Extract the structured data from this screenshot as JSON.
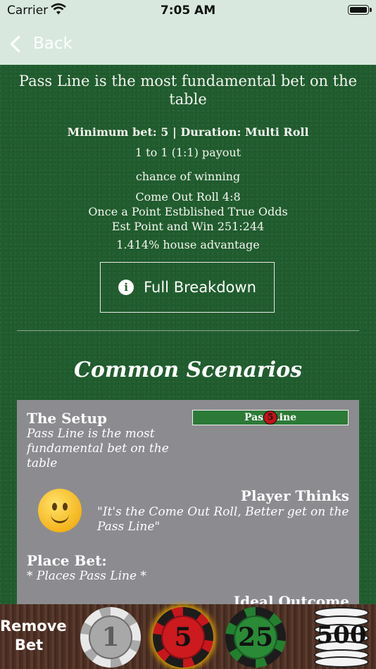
{
  "status_bar": {
    "carrier": "Carrier",
    "time": "7:05 AM"
  },
  "nav": {
    "back_label": "Back"
  },
  "bet": {
    "intro": "Pass Line is the most fundamental bet on the table",
    "summary": "Minimum bet: 5 | Duration: Multi Roll",
    "payout": "1 to 1 (1:1) payout",
    "chance_heading": "chance of winning",
    "chance_lines": [
      "Come Out Roll 4:8",
      "Once a Point Estblished True Odds",
      "Est Point and Win 251:244"
    ],
    "house_advantage": "1.414% house advantage"
  },
  "breakdown_button": {
    "label": "Full Breakdown",
    "icon": "info-icon"
  },
  "scenarios": {
    "title": "Common Scenarios",
    "setup_title": "The Setup",
    "setup_text": "Pass Line is the most fundamental bet on the table",
    "passline_label": "Pass Line",
    "placed_chip": "5",
    "player_thinks_title": "Player Thinks",
    "player_thinks_text": "\"It's the Come Out Roll, Better get on the Pass Line\"",
    "place_bet_title": "Place Bet:",
    "place_bet_text": "* Places Pass Line *",
    "ideal_outcome_title": "Ideal Outcome"
  },
  "chip_rail": {
    "remove_label_line1": "Remove",
    "remove_label_line2": "Bet",
    "chips": [
      "1",
      "5",
      "25"
    ],
    "stack_label": "500",
    "selected_chip": "5"
  },
  "colors": {
    "felt": "#215e2f",
    "nav_bg": "#d8e8df",
    "card_bg": "#8c8c90",
    "chip_red": "#c8161d",
    "chip_green": "#22802f",
    "chip_gray": "#a9a9a9"
  }
}
